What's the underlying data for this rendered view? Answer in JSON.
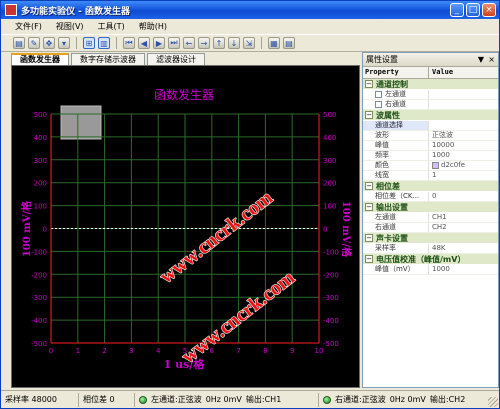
{
  "window": {
    "title": "多功能实验仪 - 函数发生器",
    "controls": [
      "minimize",
      "maximize",
      "close"
    ]
  },
  "menu": [
    {
      "label": "文件(F)"
    },
    {
      "label": "视图(V)"
    },
    {
      "label": "工具(T)"
    },
    {
      "label": "帮助(H)"
    }
  ],
  "toolbar": {
    "buttons": [
      "open-icon",
      "wand-icon",
      "cross-icon",
      "dropdown-icon",
      "grid-icon",
      "book-icon",
      "seek-start-icon",
      "step-back-icon",
      "step-fwd-icon",
      "seek-end-icon",
      "arrow-left-icon",
      "arrow-right-icon",
      "arrow-up-icon",
      "arrow-down-icon",
      "fit-icon",
      "chart-icon",
      "table-icon"
    ]
  },
  "tabs": [
    {
      "label": "函数发生器",
      "active": true
    },
    {
      "label": "数字存储示波器",
      "active": false
    },
    {
      "label": "滤波器设计",
      "active": false
    }
  ],
  "scope": {
    "title": "函数发生器",
    "ylabel_left": "100 mV/格",
    "ylabel_right": "100 mV/格",
    "xlabel": "1 us/格",
    "y_ticks_left": [
      "500",
      "400",
      "300",
      "200",
      "100",
      "0",
      "-100",
      "-200",
      "-300",
      "-400",
      "-500"
    ],
    "y_ticks_right": [
      "500",
      "400",
      "300",
      "200",
      "100",
      "0",
      "-100",
      "-200",
      "-300",
      "-400",
      "-500"
    ],
    "x_ticks": [
      "0",
      "1",
      "2",
      "3",
      "4",
      "5",
      "6",
      "7",
      "8",
      "9",
      "10"
    ],
    "watermark": "www.cncrk.com",
    "colors": {
      "axis": "#ff2020",
      "text": "#cc00cc",
      "grid": "#2b6b2b",
      "trace": "#ffffff",
      "background": "#000000"
    }
  },
  "properties": {
    "panel_title": "属性设置",
    "col_property": "Property",
    "col_value": "Value",
    "categories": [
      {
        "title": "通道控制",
        "rows": [
          {
            "key": "左通道",
            "value": "",
            "checkbox": true
          },
          {
            "key": "右通道",
            "value": "",
            "checkbox": true
          }
        ]
      },
      {
        "title": "波属性",
        "rows": [
          {
            "key": "通道选择",
            "value": "",
            "selected": true
          },
          {
            "key": "波形",
            "value": "正弦波"
          },
          {
            "key": "峰值",
            "value": "10000"
          },
          {
            "key": "频率",
            "value": "1000"
          },
          {
            "key": "颜色",
            "value": "d2c0fe",
            "swatch": true
          },
          {
            "key": "线宽",
            "value": "1"
          }
        ]
      },
      {
        "title": "相位差",
        "rows": [
          {
            "key": "相位差（CK...",
            "value": "0"
          }
        ]
      },
      {
        "title": "输出设置",
        "rows": [
          {
            "key": "左通道",
            "value": "CH1"
          },
          {
            "key": "右通道",
            "value": "CH2"
          }
        ]
      },
      {
        "title": "声卡设置",
        "rows": [
          {
            "key": "采样率",
            "value": "48K"
          }
        ]
      },
      {
        "title": "电压值校准（峰值/mV）",
        "rows": [
          {
            "key": "峰值（mV）",
            "value": "1000"
          }
        ]
      }
    ]
  },
  "status": {
    "sample_rate": "采样率 48000",
    "phase": "相位差 0",
    "left": {
      "wave": "左通道:正弦波",
      "level": "0Hz 0mV",
      "out": "输出:CH1"
    },
    "right": {
      "wave": "右通道:正弦波",
      "level": "0Hz 0mV",
      "out": "输出:CH2"
    }
  }
}
